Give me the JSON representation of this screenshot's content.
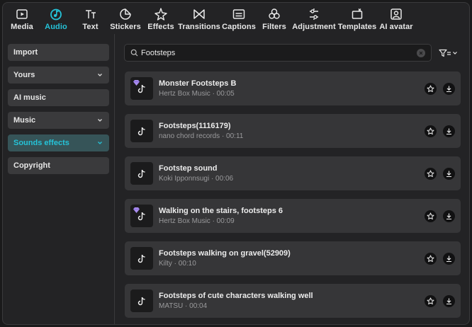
{
  "toolbar": {
    "tabs": [
      {
        "label": "Media",
        "icon": "play-square-icon"
      },
      {
        "label": "Audio",
        "icon": "music-note-circle-icon",
        "active": true
      },
      {
        "label": "Text",
        "icon": "text-icon"
      },
      {
        "label": "Stickers",
        "icon": "sticker-icon"
      },
      {
        "label": "Effects",
        "icon": "sparkle-star-icon"
      },
      {
        "label": "Transitions",
        "icon": "bowtie-icon"
      },
      {
        "label": "Captions",
        "icon": "captions-icon"
      },
      {
        "label": "Filters",
        "icon": "three-circles-icon"
      },
      {
        "label": "Adjustment",
        "icon": "sliders-icon"
      },
      {
        "label": "Templates",
        "icon": "template-icon"
      },
      {
        "label": "AI avatar",
        "icon": "avatar-icon"
      }
    ]
  },
  "sidebar": {
    "items": [
      {
        "label": "Import",
        "chevron": false
      },
      {
        "label": "Yours",
        "chevron": true
      },
      {
        "label": "AI music",
        "chevron": false
      },
      {
        "label": "Music",
        "chevron": true
      },
      {
        "label": "Sounds effects",
        "chevron": true,
        "active": true
      },
      {
        "label": "Copyright",
        "chevron": false
      }
    ]
  },
  "search": {
    "value": "Footsteps",
    "placeholder": ""
  },
  "sounds": [
    {
      "title": "Monster Footsteps B",
      "meta": "Hertz Box Music · 00:05",
      "premium": true
    },
    {
      "title": "Footsteps(1116179)",
      "meta": "nano chord records · 00:11",
      "premium": false
    },
    {
      "title": "Footstep sound",
      "meta": "Koki Ipponnsugi · 00:06",
      "premium": false
    },
    {
      "title": "Walking on the stairs, footsteps 6",
      "meta": "Hertz Box Music · 00:09",
      "premium": true
    },
    {
      "title": "Footsteps walking on gravel(52909)",
      "meta": "Kilty · 00:10",
      "premium": false
    },
    {
      "title": "Footsteps of cute characters walking well",
      "meta": "MATSU · 00:04",
      "premium": false
    }
  ],
  "colors": {
    "accent": "#25c3d8",
    "premium": "#a98cf0",
    "background": "#232325",
    "card": "#363638"
  }
}
